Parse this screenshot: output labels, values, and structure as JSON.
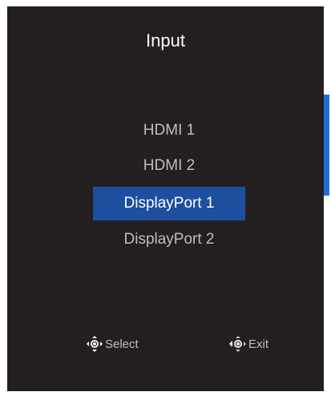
{
  "osd": {
    "title": "Input",
    "items": [
      {
        "label": "HDMI 1",
        "selected": false
      },
      {
        "label": "HDMI 2",
        "selected": false
      },
      {
        "label": "DisplayPort 1",
        "selected": true
      },
      {
        "label": "DisplayPort 2",
        "selected": false
      }
    ],
    "hints": {
      "select": {
        "icon": "joystick-icon",
        "label": "Select"
      },
      "exit": {
        "icon": "joystick-left-icon",
        "label": "Exit"
      }
    }
  },
  "colors": {
    "background": "#231f20",
    "highlight": "#1d4f9e",
    "scrollbar": "#1e6fd9",
    "text": "#bdbdbd",
    "title": "#ffffff"
  }
}
